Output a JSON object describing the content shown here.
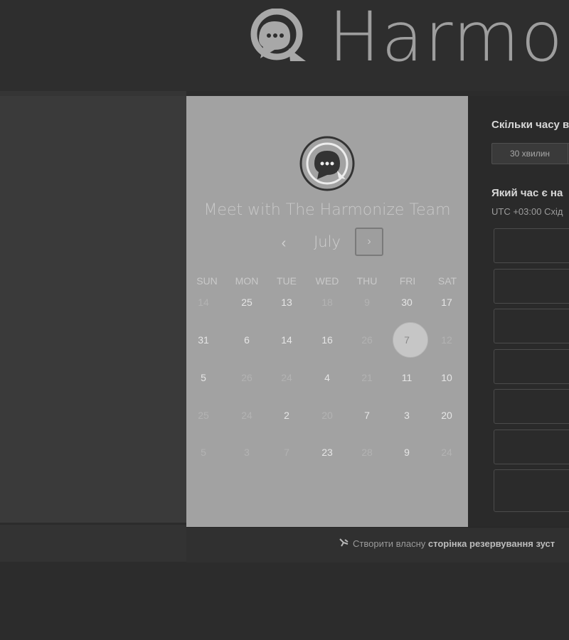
{
  "header": {
    "brand": "Harmon",
    "logo": "chat-bubble-logo"
  },
  "calendar": {
    "title": "Meet with The Harmonize Team",
    "month": "July",
    "prev_icon": "chevron-left",
    "next_icon": "chevron-right",
    "weekdays": [
      "SUN",
      "MON",
      "TUE",
      "WED",
      "THU",
      "FRI",
      "SAT"
    ],
    "weeks": [
      [
        {
          "d": "14",
          "a": false
        },
        {
          "d": "25",
          "a": true
        },
        {
          "d": "13",
          "a": true
        },
        {
          "d": "18",
          "a": false
        },
        {
          "d": "9",
          "a": false
        },
        {
          "d": "30",
          "a": true
        },
        {
          "d": "17",
          "a": true
        }
      ],
      [
        {
          "d": "31",
          "a": true
        },
        {
          "d": "6",
          "a": true
        },
        {
          "d": "14",
          "a": true
        },
        {
          "d": "16",
          "a": true
        },
        {
          "d": "26",
          "a": false
        },
        {
          "d": "7",
          "a": true,
          "selected": true
        },
        {
          "d": "12",
          "a": false
        }
      ],
      [
        {
          "d": "5",
          "a": true
        },
        {
          "d": "26",
          "a": false
        },
        {
          "d": "24",
          "a": false
        },
        {
          "d": "4",
          "a": true
        },
        {
          "d": "21",
          "a": false
        },
        {
          "d": "11",
          "a": true
        },
        {
          "d": "10",
          "a": true
        }
      ],
      [
        {
          "d": "25",
          "a": false
        },
        {
          "d": "24",
          "a": false
        },
        {
          "d": "2",
          "a": true
        },
        {
          "d": "20",
          "a": false
        },
        {
          "d": "7",
          "a": true
        },
        {
          "d": "3",
          "a": true
        },
        {
          "d": "20",
          "a": true
        }
      ],
      [
        {
          "d": "5",
          "a": false
        },
        {
          "d": "3",
          "a": false
        },
        {
          "d": "7",
          "a": false
        },
        {
          "d": "23",
          "a": true
        },
        {
          "d": "28",
          "a": false
        },
        {
          "d": "9",
          "a": true
        },
        {
          "d": "24",
          "a": false
        }
      ]
    ]
  },
  "booking": {
    "duration_question": "Скільки часу в",
    "duration_option": "30 хвилин",
    "time_question": "Який час є на",
    "timezone": "UTC +03:00 Схід",
    "slot_count": 7
  },
  "footer": {
    "prefix": "Створити власну",
    "link": "сторінка резервування зуст",
    "icon": "scheduler-icon"
  }
}
